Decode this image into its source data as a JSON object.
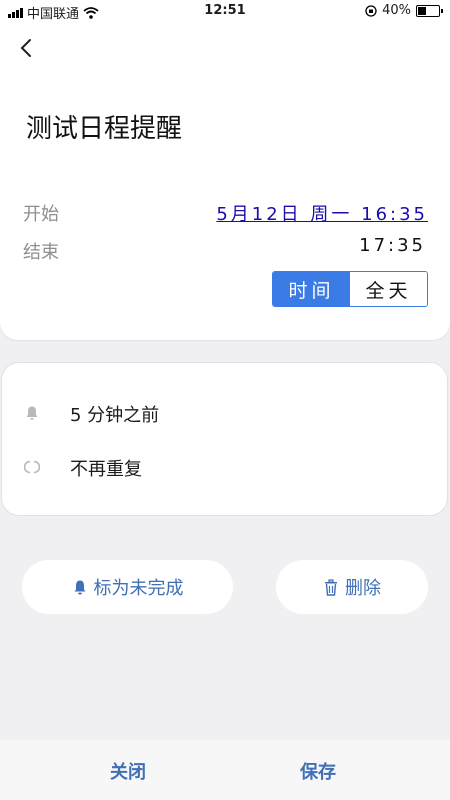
{
  "status_bar": {
    "carrier": "中国联通",
    "time": "12:51",
    "battery_percent": "40%",
    "battery_level": 0.4
  },
  "event": {
    "title": "测试日程提醒",
    "start_label": "开始",
    "start_value": "5月12日 周一 16:35",
    "end_label": "结束",
    "end_value": "17:35"
  },
  "time_toggle": {
    "options": [
      "时间",
      "全天"
    ],
    "selected": "时间"
  },
  "details": {
    "reminder_text": "5 分钟之前",
    "repeat_text": "不再重复"
  },
  "actions": {
    "mark_incomplete": "标为未完成",
    "delete": "删除"
  },
  "bottom_bar": {
    "close": "关闭",
    "save": "保存"
  },
  "colors": {
    "accent": "#3b7be6",
    "action_text": "#3f6fb5",
    "link": "#1a0dab",
    "background": "#f0f0f2"
  },
  "icons": {
    "back": "chevron-left-icon",
    "reminder": "bell-icon",
    "repeat": "repeat-icon",
    "mark_incomplete": "bell-icon",
    "delete": "trash-icon"
  }
}
